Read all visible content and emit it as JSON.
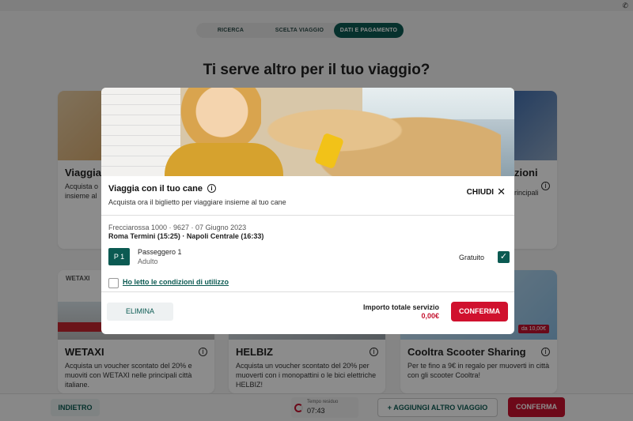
{
  "stepper": {
    "steps": [
      "RICERCA",
      "SCELTA VIAGGIO",
      "DATI E PAGAMENTO"
    ]
  },
  "page": {
    "title": "Ti serve altro per il tuo viaggio?"
  },
  "cards": {
    "c1": {
      "title": "Viaggia",
      "text": "Acquista o\ninsieme al"
    },
    "c2": {
      "title": "zioni",
      "text": "rincipali"
    },
    "wetaxi": {
      "brand": "WETAXI",
      "title": "WETAXI",
      "text": "Acquista un voucher scontato del 20% e muoviti con WETAXI nelle principali città italiane."
    },
    "helbiz": {
      "title": "HELBIZ",
      "text": "Acquista un voucher scontato del 20% per muoverti con i monopattini o le bici elettriche HELBIZ!"
    },
    "cooltra": {
      "title": "Cooltra Scooter Sharing",
      "text": "Per te fino a 9€ in regalo per muoverti in città con gli scooter Cooltra!",
      "badge": "da 10,00€"
    }
  },
  "modal": {
    "title": "Viaggia con il tuo cane",
    "subtitle": "Acquista ora il biglietto per viaggiare insieme al tuo cane",
    "close_label": "CHIUDI",
    "train": "Frecciarossa 1000 · 9627 · 07 Giugno 2023",
    "route": "Roma Termini (15:25) · Napoli Centrale (16:33)",
    "passenger": {
      "badge": "P 1",
      "name": "Passeggero 1",
      "type": "Adulto",
      "price": "Gratuito",
      "checked": true
    },
    "terms_label": "Ho letto le condizioni di utilizzo",
    "delete_label": "ELIMINA",
    "total_label": "Importo totale servizio",
    "total_value": "0,00€",
    "confirm_label": "CONFERMA"
  },
  "bottom": {
    "back_label": "INDIETRO",
    "timer_label": "Tempo residuo",
    "timer_value": "07:43",
    "add_trip_label": "+ AGGIUNGI ALTRO VIAGGIO",
    "confirm_label": "CONFERMA"
  },
  "colors": {
    "primary": "#0b5a52",
    "accent": "#c4122e",
    "overlay": "rgba(0,0,0,0.45)"
  }
}
